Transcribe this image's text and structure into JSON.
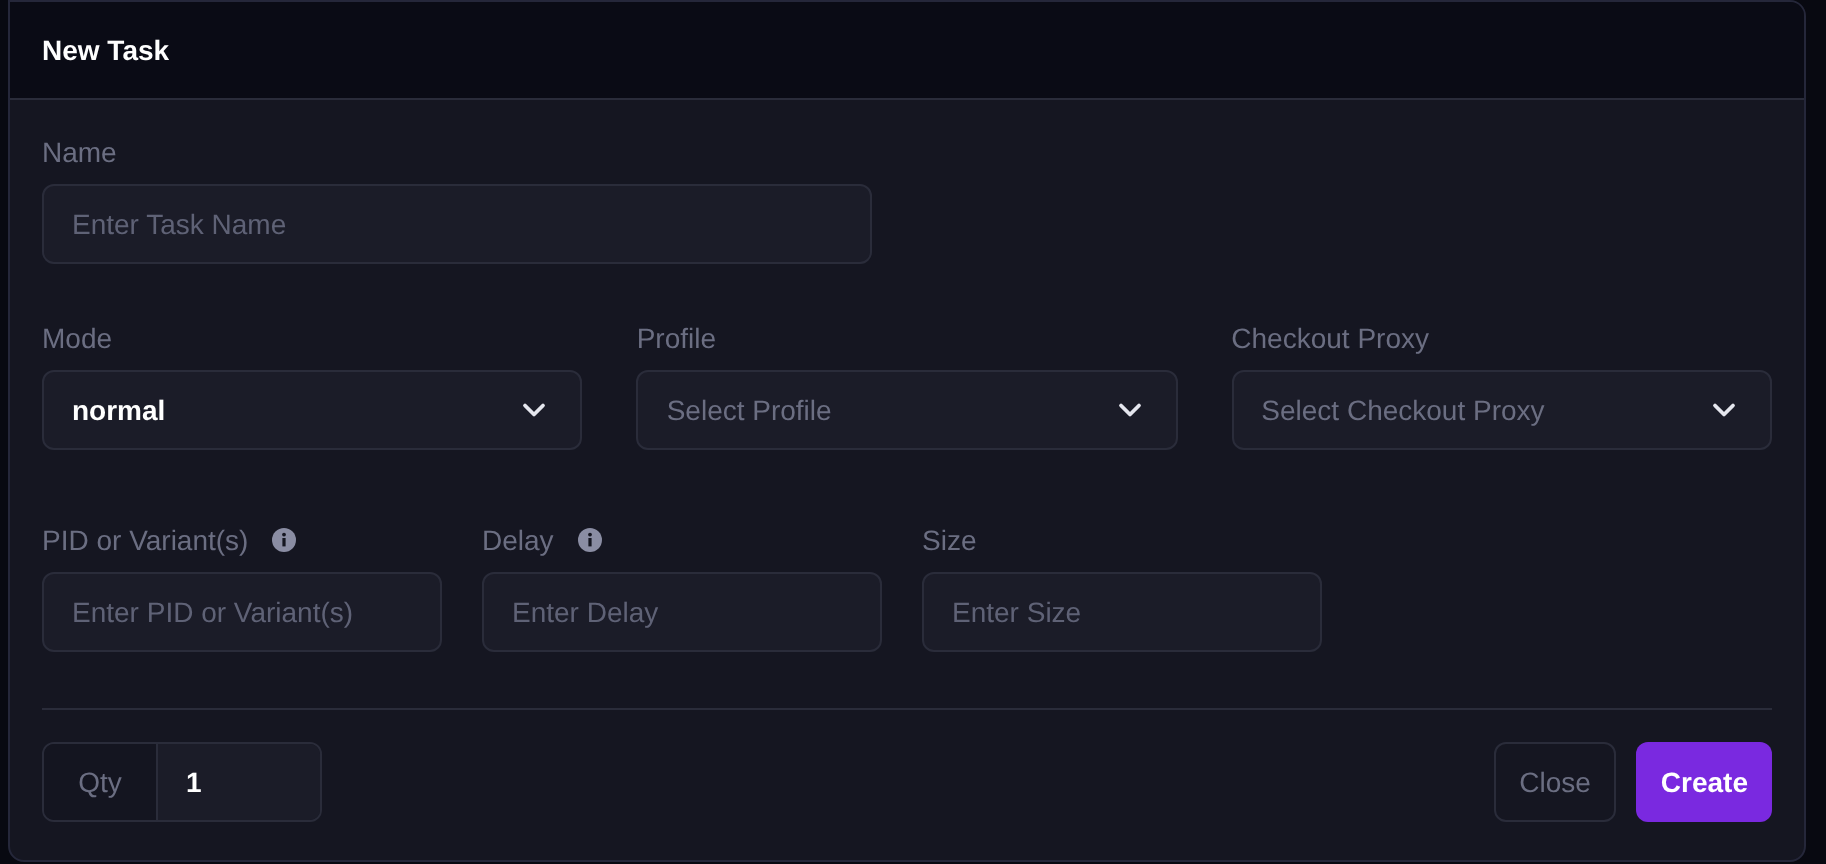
{
  "dialog": {
    "title": "New Task"
  },
  "name_field": {
    "label": "Name",
    "placeholder": "Enter Task Name"
  },
  "selects": [
    {
      "label": "Mode",
      "value": "normal"
    },
    {
      "label": "Profile",
      "placeholder": "Select Profile"
    },
    {
      "label": "Checkout Proxy",
      "placeholder": "Select Checkout Proxy"
    }
  ],
  "inputs": [
    {
      "label": "PID or Variant(s)",
      "placeholder": "Enter PID or Variant(s)",
      "info": true
    },
    {
      "label": "Delay",
      "placeholder": "Enter Delay",
      "info": true
    },
    {
      "label": "Size",
      "placeholder": "Enter Size",
      "info": false
    }
  ],
  "qty": {
    "label": "Qty",
    "value": "1"
  },
  "buttons": [
    {
      "label": "Close",
      "kind": "secondary"
    },
    {
      "label": "Create",
      "kind": "primary"
    }
  ]
}
